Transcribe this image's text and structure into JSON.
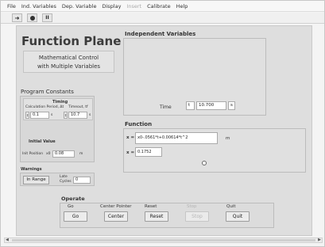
{
  "menu": {
    "items": [
      "File",
      "Ind. Variables",
      "Dep. Variable",
      "Display",
      "Insert",
      "Calibrate",
      "Help"
    ]
  },
  "toolbar": {
    "run_icon": "arrow-right-icon",
    "stop_icon": "stop-icon",
    "pause_icon": "pause-icon"
  },
  "panel": {
    "title": "Function Plane",
    "subtitle_line1": "Mathematical Control",
    "subtitle_line2": "with Multiple Variables"
  },
  "constants": {
    "label": "Program Constants",
    "timing_label": "Timing",
    "calc_period_label": "Calculation Period, Δt",
    "calc_period_value": "0.1",
    "calc_period_unit": "s",
    "timeout_label": "Timeout, tf",
    "timeout_value": "10.7",
    "timeout_unit": "s",
    "initial_value_label": "Initial Value",
    "init_position_label": "Init Position",
    "init_position_var": "x0",
    "init_position_value": "0.08",
    "init_position_unit": "m"
  },
  "warnings": {
    "label": "Warnings",
    "in_range": "In Range",
    "late_cycles_label_1": "Late",
    "late_cycles_label_2": "Cycles",
    "late_cycles_value": "0"
  },
  "independent": {
    "label": "Independent Variables",
    "time_label": "Time",
    "time_var": "t",
    "time_value": "10.700",
    "time_unit": "s"
  },
  "function": {
    "label": "Function",
    "expr_var": "x =",
    "expr_value": "x0-.0561*t+0.00614*t^2",
    "expr_unit": "m",
    "result_var": "x =",
    "result_value": "0.1752"
  },
  "operate": {
    "label": "Operate",
    "columns": [
      {
        "label": "Go",
        "button": "Go",
        "enabled": true
      },
      {
        "label": "Center Pointer",
        "button": "Center",
        "enabled": true
      },
      {
        "label": "Reset",
        "button": "Reset",
        "enabled": true
      },
      {
        "label": "Stop",
        "button": "Stop",
        "enabled": false
      },
      {
        "label": "Quit",
        "button": "Quit",
        "enabled": true
      }
    ]
  }
}
